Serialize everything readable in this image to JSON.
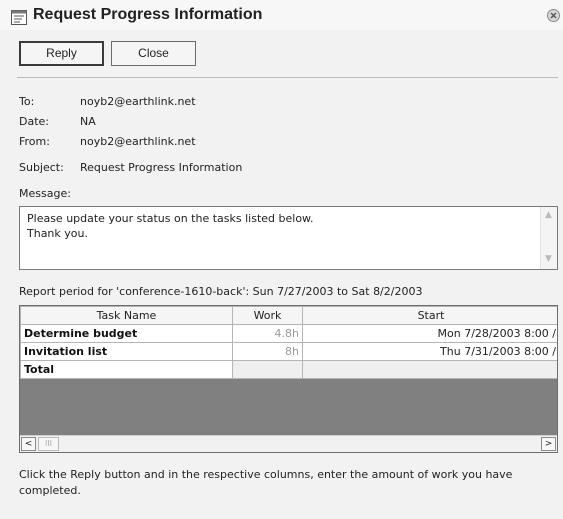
{
  "window": {
    "title": "Request Progress Information"
  },
  "toolbar": {
    "reply_label": "Reply",
    "close_label": "Close"
  },
  "header": {
    "to_label": "To:",
    "to_value": "noyb2@earthlink.net",
    "date_label": "Date:",
    "date_value": "NA",
    "from_label": "From:",
    "from_value": "noyb2@earthlink.net",
    "subject_label": "Subject:",
    "subject_value": "Request Progress Information"
  },
  "message": {
    "label": "Message:",
    "body": "Please update your status on the tasks listed below.\nThank you."
  },
  "report": {
    "period": "Report period for 'conference-1610-back': Sun 7/27/2003 to Sat 8/2/2003",
    "columns": [
      "Task Name",
      "Work",
      "Start"
    ],
    "rows": [
      {
        "task": "Determine budget",
        "work": "4.8h",
        "start": "Mon 7/28/2003 8:00 /"
      },
      {
        "task": "Invitation list",
        "work": "8h",
        "start": "Thu 7/31/2003 8:00 /"
      },
      {
        "task": "Total",
        "work": "",
        "start": ""
      }
    ]
  },
  "scrollbar": {
    "left_arrow": "<",
    "thumb_grip": "III",
    "right_arrow": ">"
  },
  "footer": {
    "instructions": "Click the Reply button and in the respective columns, enter the amount of work you have completed."
  },
  "icons": {
    "title": "project-request-icon",
    "close": "close-icon"
  },
  "colors": {
    "grid_background": "#808080",
    "work_text": "#9a9a9a"
  }
}
